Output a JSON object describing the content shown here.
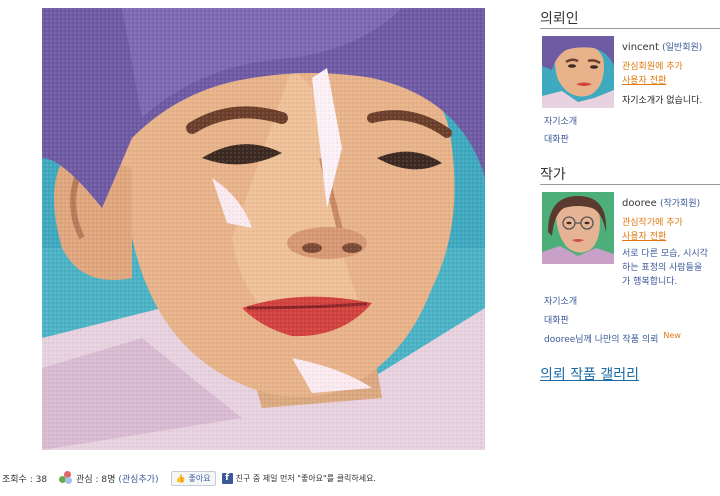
{
  "stats": {
    "views_label": "조회수 : 38",
    "interest_label": "관심 : 8명",
    "add_interest": "(관심추가)",
    "like_button": "좋아요",
    "fb_message": "친구 중 제일 먼저 \"좋아요\"를 클릭하세요."
  },
  "requester": {
    "section_title": "의뢰인",
    "name": "vincent",
    "grade": "(일반회원)",
    "add_interest": "관심회원에 추가",
    "switch_user": "사용자 전환",
    "intro": "자기소개가 없습니다.",
    "links": [
      "자기소개",
      "대화판"
    ]
  },
  "artist": {
    "section_title": "작가",
    "name": "dooree",
    "grade": "(작가회원)",
    "add_interest": "관심작가에 추가",
    "switch_user": "사용자 전환",
    "intro_lines": [
      "서로 다른 모습, 시시각",
      "하는 표정의 사람들을 ",
      "가 행복합니다."
    ],
    "links": [
      "자기소개",
      "대화판"
    ],
    "commission_link": "dooree님께 나만의 작품 의뢰",
    "new_badge": "New"
  },
  "gallery_link": "의뢰 작품 갤러리",
  "colors": {
    "link_blue": "#3b5998",
    "orange": "#e07a10",
    "gallery_blue": "#1a6aa6",
    "painting_purple": "#6f5aa4",
    "painting_teal": "#3fa9bf",
    "painting_skin": "#e8b38a"
  }
}
